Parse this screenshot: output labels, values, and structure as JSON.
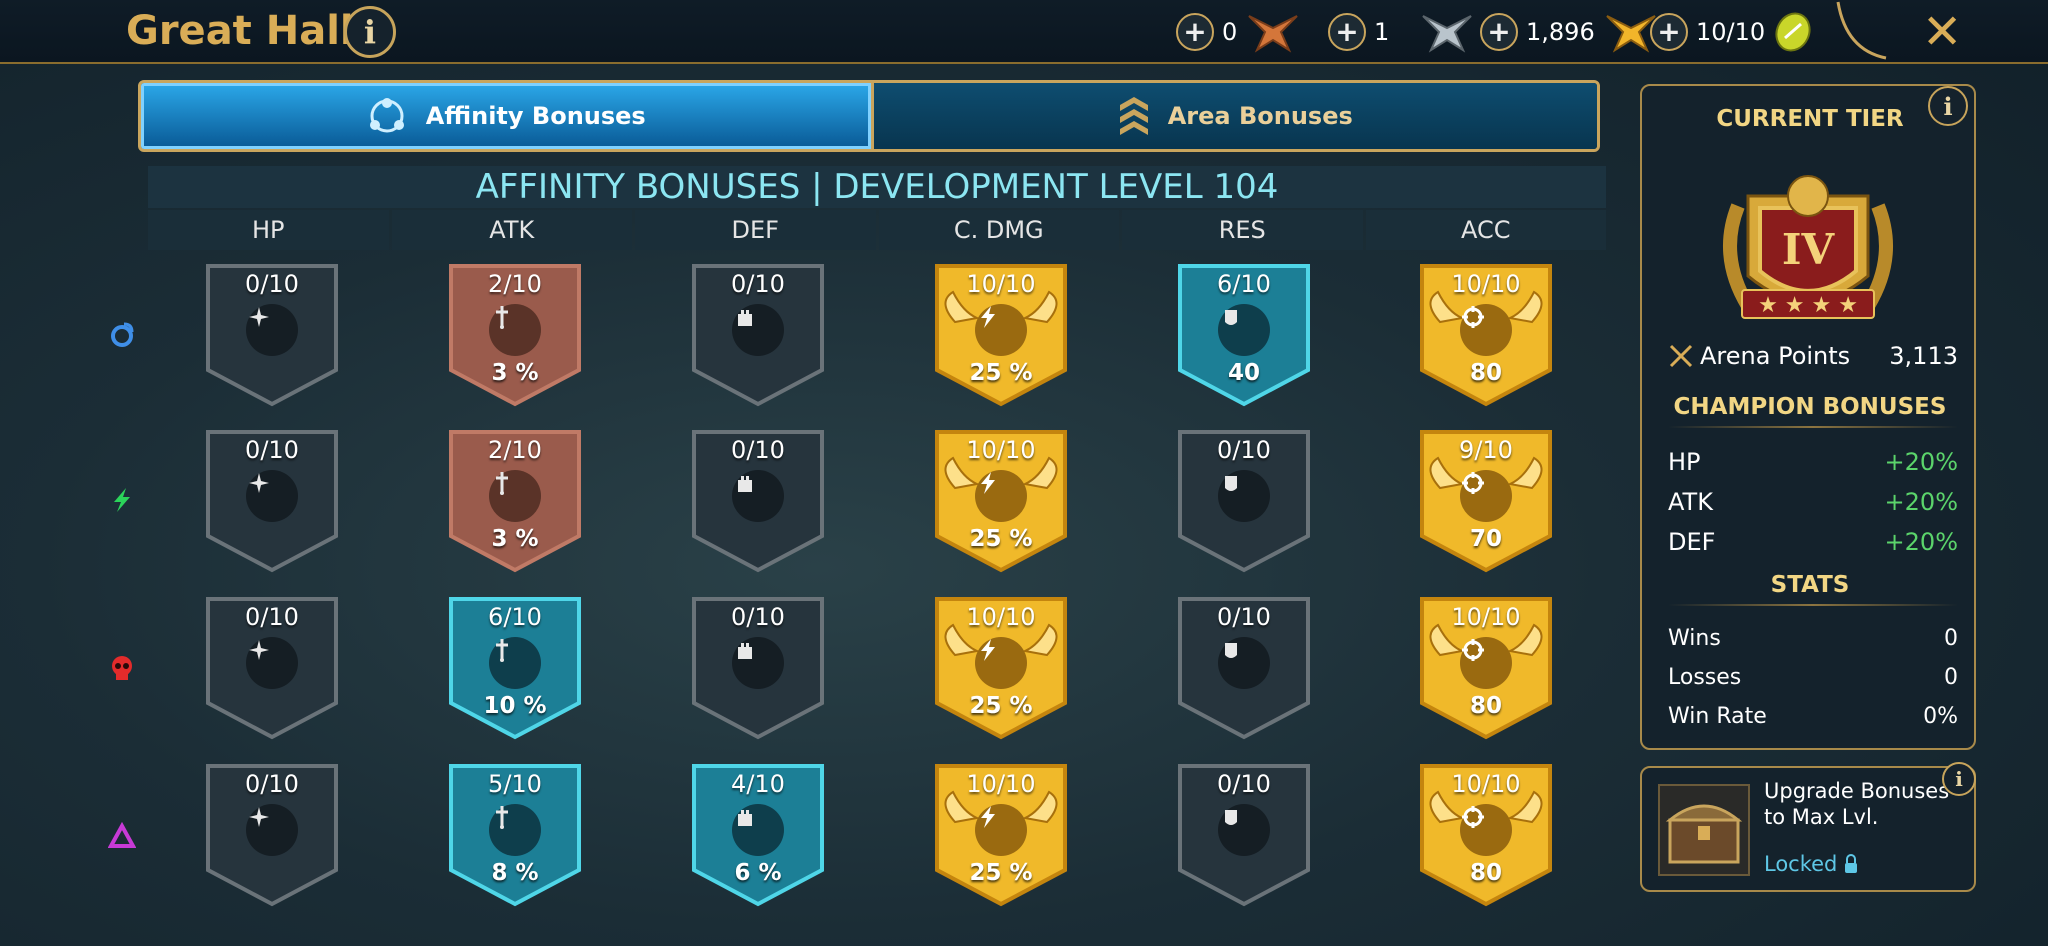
{
  "header": {
    "title": "Great Hall",
    "currencies": [
      {
        "value": "0",
        "icon": "bronze-medal-icon"
      },
      {
        "value": "1",
        "icon": "silver-medal-icon"
      },
      {
        "value": "1,896",
        "icon": "gold-medal-icon"
      },
      {
        "value": "10/10",
        "icon": "arena-token-icon"
      }
    ],
    "close_label": "✕"
  },
  "tabs": [
    {
      "label": "Affinity Bonuses",
      "active": true
    },
    {
      "label": "Area Bonuses",
      "active": false
    }
  ],
  "grid": {
    "title": "AFFINITY BONUSES | DEVELOPMENT LEVEL 104",
    "columns": [
      "HP",
      "ATK",
      "DEF",
      "C. DMG",
      "RES",
      "ACC"
    ],
    "rows": [
      {
        "affinity": "magic",
        "cells": [
          {
            "level": "0/10",
            "value": "",
            "style": "gray"
          },
          {
            "level": "2/10",
            "value": "3 %",
            "style": "bronze"
          },
          {
            "level": "0/10",
            "value": "",
            "style": "gray"
          },
          {
            "level": "10/10",
            "value": "25 %",
            "style": "gold"
          },
          {
            "level": "6/10",
            "value": "40",
            "style": "teal"
          },
          {
            "level": "10/10",
            "value": "80",
            "style": "gold"
          }
        ]
      },
      {
        "affinity": "spirit",
        "cells": [
          {
            "level": "0/10",
            "value": "",
            "style": "gray"
          },
          {
            "level": "2/10",
            "value": "3 %",
            "style": "bronze"
          },
          {
            "level": "0/10",
            "value": "",
            "style": "gray"
          },
          {
            "level": "10/10",
            "value": "25 %",
            "style": "gold"
          },
          {
            "level": "0/10",
            "value": "",
            "style": "gray"
          },
          {
            "level": "9/10",
            "value": "70",
            "style": "gold"
          }
        ]
      },
      {
        "affinity": "force",
        "cells": [
          {
            "level": "0/10",
            "value": "",
            "style": "gray"
          },
          {
            "level": "6/10",
            "value": "10 %",
            "style": "teal"
          },
          {
            "level": "0/10",
            "value": "",
            "style": "gray"
          },
          {
            "level": "10/10",
            "value": "25 %",
            "style": "gold"
          },
          {
            "level": "0/10",
            "value": "",
            "style": "gray"
          },
          {
            "level": "10/10",
            "value": "80",
            "style": "gold"
          }
        ]
      },
      {
        "affinity": "void",
        "cells": [
          {
            "level": "0/10",
            "value": "",
            "style": "gray"
          },
          {
            "level": "5/10",
            "value": "8 %",
            "style": "teal"
          },
          {
            "level": "4/10",
            "value": "6 %",
            "style": "teal"
          },
          {
            "level": "10/10",
            "value": "25 %",
            "style": "gold"
          },
          {
            "level": "0/10",
            "value": "",
            "style": "gray"
          },
          {
            "level": "10/10",
            "value": "80",
            "style": "gold"
          }
        ]
      }
    ]
  },
  "panel": {
    "current_tier_label": "CURRENT TIER",
    "tier": "IV",
    "arena_points_label": "Arena Points",
    "arena_points": "3,113",
    "champion_bonuses_label": "CHAMPION BONUSES",
    "bonuses": [
      {
        "stat": "HP",
        "value": "+20%"
      },
      {
        "stat": "ATK",
        "value": "+20%"
      },
      {
        "stat": "DEF",
        "value": "+20%"
      }
    ],
    "stats_label": "STATS",
    "stats": [
      {
        "label": "Wins",
        "value": "0"
      },
      {
        "label": "Losses",
        "value": "0"
      },
      {
        "label": "Win Rate",
        "value": "0%"
      }
    ]
  },
  "upgrade": {
    "text": "Upgrade Bonuses to Max Lvl.",
    "status": "Locked"
  },
  "colors": {
    "gold": "#f0b92a",
    "teal": "#1c7f96",
    "bronze": "#9a5b4c",
    "gray": "#26343d"
  }
}
